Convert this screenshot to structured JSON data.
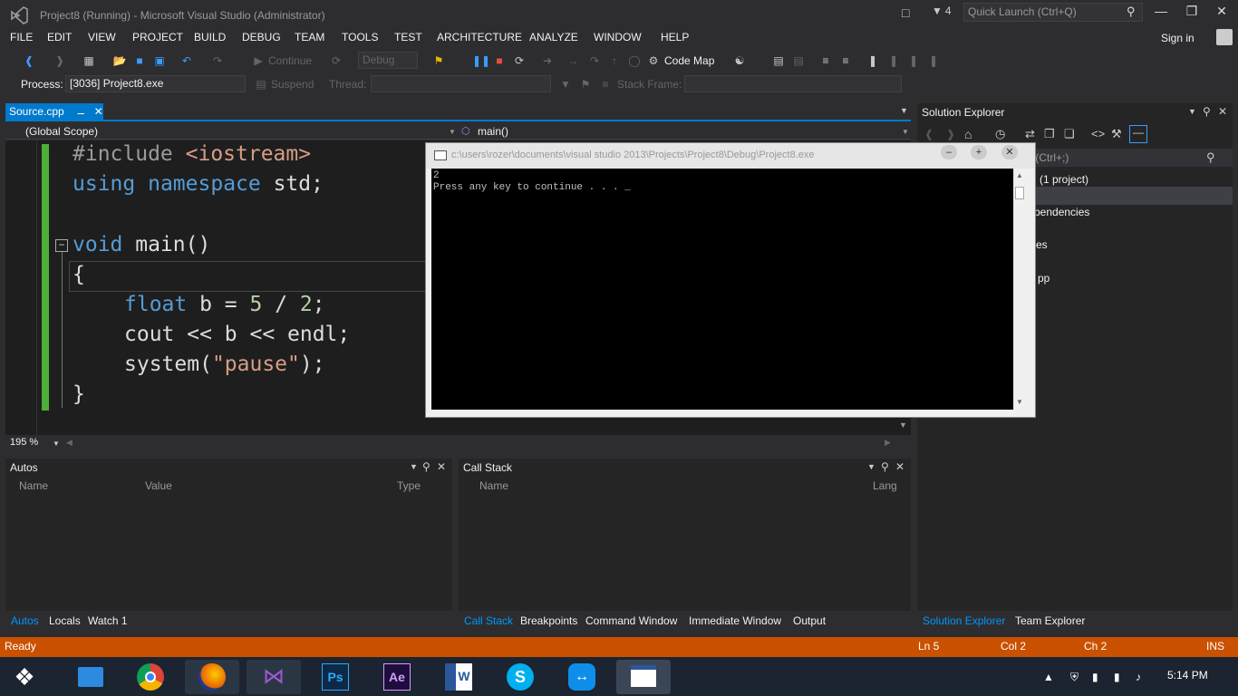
{
  "window": {
    "title": "Project8 (Running) - Microsoft Visual Studio (Administrator)",
    "notification_count": "4",
    "quick_launch_placeholder": "Quick Launch (Ctrl+Q)"
  },
  "menu": [
    "FILE",
    "EDIT",
    "VIEW",
    "PROJECT",
    "BUILD",
    "DEBUG",
    "TEAM",
    "TOOLS",
    "TEST",
    "ARCHITECTURE",
    "ANALYZE",
    "WINDOW",
    "HELP"
  ],
  "signin": "Sign in",
  "toolbar": {
    "continue_label": "Continue",
    "config_value": "Debug",
    "code_map_label": "Code Map",
    "process_label": "Process:",
    "process_value": "[3036] Project8.exe",
    "suspend_label": "Suspend",
    "thread_label": "Thread:",
    "stack_frame_label": "Stack Frame:"
  },
  "editor": {
    "tab_label": "Source.cpp",
    "scope_value": "(Global Scope)",
    "member_value": "main()",
    "zoom": "195 %",
    "code": {
      "l1_pp": "#include",
      "l1_rest": " <iostream>",
      "l2_kw1": "using",
      "l2_kw2": "namespace",
      "l2_rest": " std;",
      "l3_kw": "void",
      "l3_rest": " main()",
      "l4": "{",
      "l5_kw": "float",
      "l5_a": " b = ",
      "l5_n1": "5",
      "l5_b": " / ",
      "l5_n2": "2",
      "l5_c": ";",
      "l6": "cout << b << endl;",
      "l7_a": "system(",
      "l7_str": "\"pause\"",
      "l7_b": ");",
      "l8": "}"
    }
  },
  "console": {
    "title": "c:\\users\\rozer\\documents\\visual studio 2013\\Projects\\Project8\\Debug\\Project8.exe",
    "output_line1": "2",
    "output_line2": "Press any key to continue . . . _"
  },
  "solution_explorer": {
    "title": "Solution Explorer",
    "search_placeholder": "r (Ctrl+;)",
    "items": [
      "(1 project)",
      "pendencies",
      "es",
      "pp"
    ]
  },
  "autos": {
    "title": "Autos",
    "columns": [
      "Name",
      "Value",
      "Type"
    ]
  },
  "call_stack": {
    "title": "Call Stack",
    "columns": [
      "Name",
      "Lang"
    ]
  },
  "bottom_tabs_left": [
    "Autos",
    "Locals",
    "Watch 1"
  ],
  "bottom_tabs_right": [
    "Call Stack",
    "Breakpoints",
    "Command Window",
    "Immediate Window",
    "Output"
  ],
  "bottom_tabs_sol": [
    "Solution Explorer",
    "Team Explorer"
  ],
  "status": {
    "state": "Ready",
    "ln": "Ln 5",
    "col": "Col 2",
    "ch": "Ch 2",
    "ins": "INS"
  },
  "taskbar": {
    "time": "5:14 PM"
  }
}
